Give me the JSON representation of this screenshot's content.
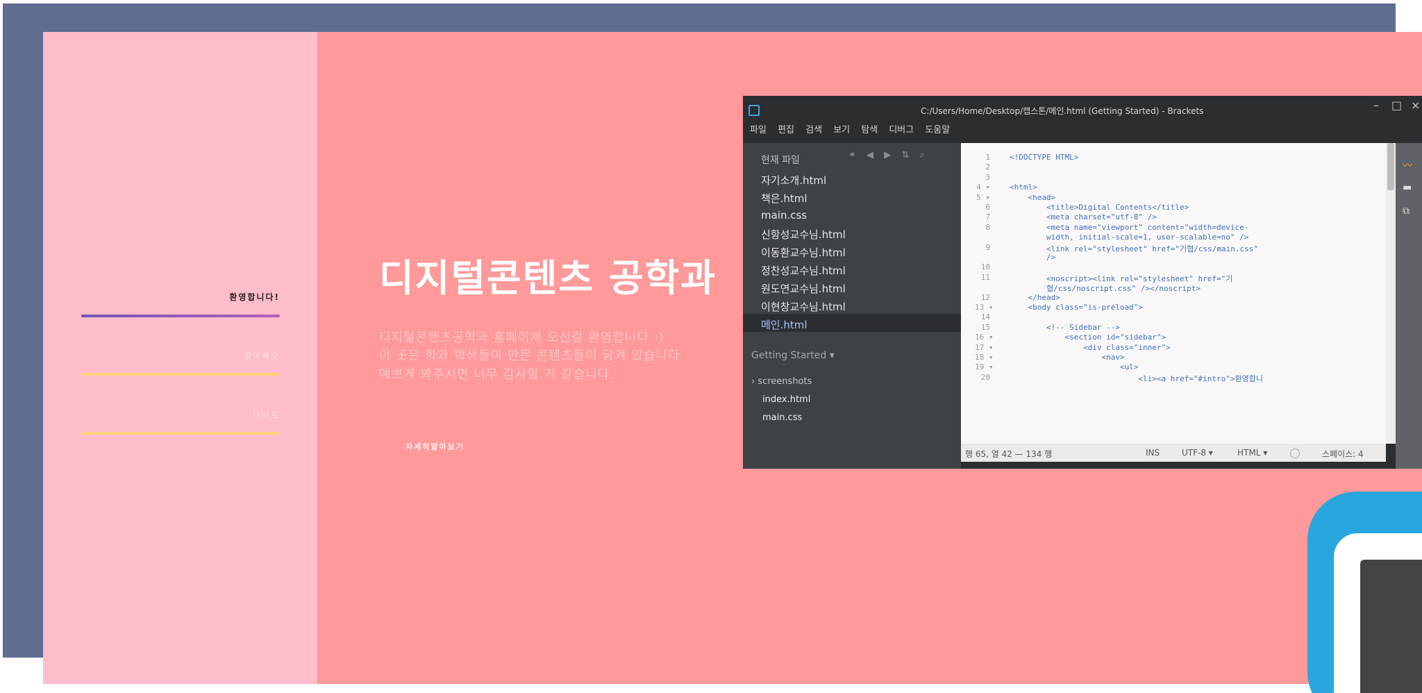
{
  "site": {
    "nav": [
      "환영합니다!",
      "좋아해요",
      "다녀요"
    ],
    "hero_title": "디지털콘텐츠 공학과",
    "hero_lines": [
      "디지털콘텐츠공학과 홈페이제 오신걸 환영합니다 :)",
      "이 곳은 학과 학생들이 만든 콘텐츠들이 담겨 있습니다",
      "예쁘게 봐주시면 너무 감사할 거 같습니다."
    ],
    "more_button": "자세히알아보기"
  },
  "editor": {
    "window_title": "C:/Users/Home/Desktop/캡스톤/메인.html (Getting Started) - Brackets",
    "window_controls": [
      "–",
      "□",
      "×"
    ],
    "menu": [
      "파일",
      "편집",
      "검색",
      "보기",
      "탐색",
      "디버그",
      "도움말"
    ],
    "sidebar_title": "현재 파일",
    "sidebar_tools": [
      "⚭",
      "◀",
      "▶",
      "⇅",
      "⌕"
    ],
    "files": [
      "자기소개.html",
      "책은.html",
      "main.css",
      "신항성교수님.html",
      "이동환교수님.html",
      "정찬성교수님.html",
      "원도연교수님.html",
      "이현창교수님.html",
      "메인.html"
    ],
    "selected_file": "메인.html",
    "project_label": "Getting Started ▾",
    "tree": [
      "› screenshots",
      "index.html",
      "main.css"
    ],
    "code_lines": [
      {
        "n": "1",
        "t": "<!DOCTYPE HTML>"
      },
      {
        "n": "2",
        "t": ""
      },
      {
        "n": "3",
        "t": ""
      },
      {
        "n": "4 ▾",
        "t": "<html>"
      },
      {
        "n": "5 ▾",
        "t": "    <head>"
      },
      {
        "n": "6",
        "t": "        <title>Digital Contents</title>"
      },
      {
        "n": "7",
        "t": "        <meta charset=\"utf-8\" />"
      },
      {
        "n": "8",
        "t": "        <meta name=\"viewport\" content=\"width=device-"
      },
      {
        "n": "",
        "t": "        width, initial-scale=1, user-scalable=no\" />"
      },
      {
        "n": "9",
        "t": "        <link rel=\"stylesheet\" href=\"기협/css/main.css\""
      },
      {
        "n": "",
        "t": "        />"
      },
      {
        "n": "10",
        "t": ""
      },
      {
        "n": "11",
        "t": "        <noscript><link rel=\"stylesheet\" href=\"기"
      },
      {
        "n": "",
        "t": "        협/css/noscript.css\" /></noscript>"
      },
      {
        "n": "12",
        "t": "    </head>"
      },
      {
        "n": "13 ▾",
        "t": "    <body class=\"is-preload\">"
      },
      {
        "n": "14",
        "t": ""
      },
      {
        "n": "15",
        "t": "        <!-- Sidebar -->"
      },
      {
        "n": "16 ▾",
        "t": "            <section id=\"sidebar\">"
      },
      {
        "n": "17 ▾",
        "t": "                <div class=\"inner\">"
      },
      {
        "n": "18 ▾",
        "t": "                    <nav>"
      },
      {
        "n": "19 ▾",
        "t": "                        <ul>"
      },
      {
        "n": "20",
        "t": "                            <li><a href=\"#intro\">환영합니"
      }
    ],
    "status": {
      "pos": "행 65, 열 42 — 134 행",
      "ins": "INS",
      "encoding": "UTF-8 ▾",
      "lang": "HTML ▾",
      "spaces": "스페이스: 4"
    }
  },
  "colors": {
    "backdrop": "#5f6e90",
    "page_bg": "#ff999a",
    "sidebar_bg": "#ffbccb",
    "accent_line": "#ffd27a",
    "logo_blue": "#2aa6de"
  }
}
